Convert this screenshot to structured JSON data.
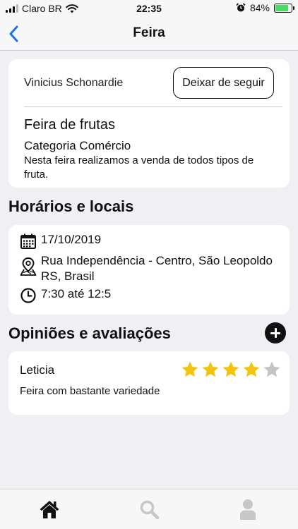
{
  "status_bar": {
    "carrier": "Claro BR",
    "time": "22:35",
    "battery": "84%",
    "icons": [
      "signal-icon",
      "wifi-icon",
      "alarm-icon",
      "battery-icon"
    ]
  },
  "nav": {
    "title": "Feira",
    "back_icon": "chevron-left-icon",
    "accent": "#1a73e8"
  },
  "feira": {
    "author": "Vinicius Schonardie",
    "unfollow_label": "Deixar de seguir",
    "title": "Feira de frutas",
    "category": "Categoria Comércio",
    "description": "Nesta feira realizamos a venda de todos tipos de fruta."
  },
  "schedule": {
    "section_title": "Horários e locais",
    "date": "17/10/2019",
    "address": "Rua Independência - Centro, São Leopoldo RS, Brasil",
    "time": "7:30 até 12:5",
    "icons": [
      "calendar-icon",
      "map-pin-icon",
      "clock-icon"
    ]
  },
  "reviews": {
    "section_title": "Opiniões e avaliações",
    "add_icon": "plus-circle-icon",
    "items": [
      {
        "reviewer": "Leticia",
        "text": "Feira com bastante variedade",
        "rating": 4,
        "max_rating": 5
      }
    ],
    "star_color": "#f2c40f",
    "star_empty_color": "#c4c4c4"
  },
  "tab_bar": {
    "tabs": [
      {
        "icon": "home-icon",
        "active": true
      },
      {
        "icon": "search-icon",
        "active": false
      },
      {
        "icon": "profile-icon",
        "active": false
      }
    ]
  }
}
